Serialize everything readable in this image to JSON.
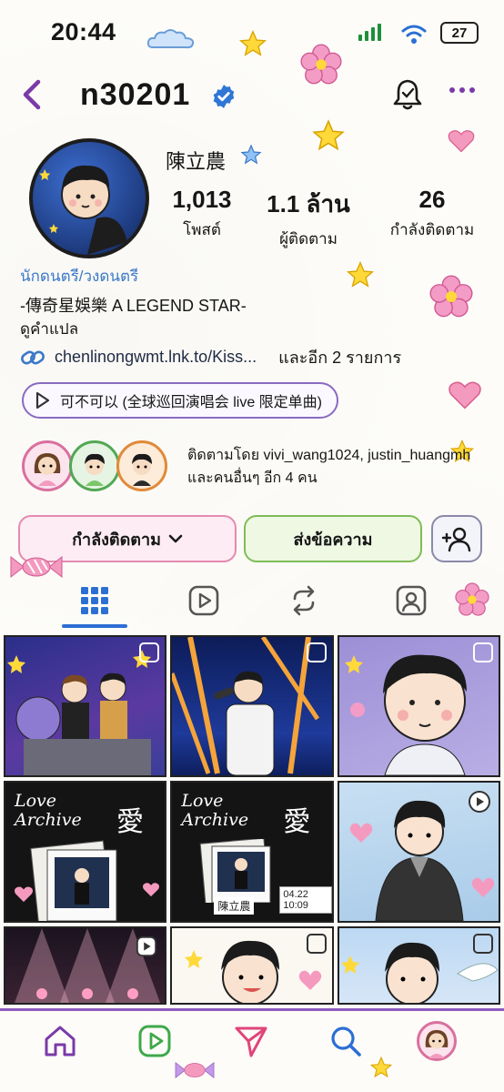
{
  "status": {
    "time": "20:44",
    "battery": "27"
  },
  "header": {
    "username": "n30201"
  },
  "profile": {
    "display_name": "陳立農",
    "stats": [
      {
        "value": "1,013",
        "label": "โพสต์"
      },
      {
        "value": "1.1 ล้าน",
        "label": "ผู้ติดตาม"
      },
      {
        "value": "26",
        "label": "กำลังติดตาม"
      }
    ],
    "category": "นักดนตรี/วงดนตรี",
    "bio": "-傳奇星娛樂 A LEGEND STAR-",
    "translate_label": "ดูคำแปล",
    "link": "chenlinongwmt.lnk.to/Kiss...",
    "link_more": "และอีก 2 รายการ",
    "music": "可不可以 (全球巡回演唱会 live 限定单曲)",
    "followed_by": "ติดตามโดย vivi_wang1024, justin_huangmh และคนอื่นๆ อีก 4 คน"
  },
  "actions": {
    "following_label": "กำลังติดตาม",
    "message_label": "ส่งข้อความ"
  },
  "colors": {
    "accent_blue": "#3b78c8",
    "tab_active": "#2c6fd4",
    "nav_border": "#8e5ac0"
  },
  "posts": [
    {
      "text_a": "",
      "text_b": ""
    },
    {
      "text_a": "",
      "text_b": ""
    },
    {
      "text_a": "",
      "text_b": ""
    },
    {
      "text_a": "Love Archive",
      "text_b": "愛"
    },
    {
      "text_a": "Love Archive",
      "text_b": "愛",
      "caption": "陳立農",
      "date": "04.22 10:09"
    },
    {
      "text_a": "",
      "text_b": ""
    }
  ]
}
